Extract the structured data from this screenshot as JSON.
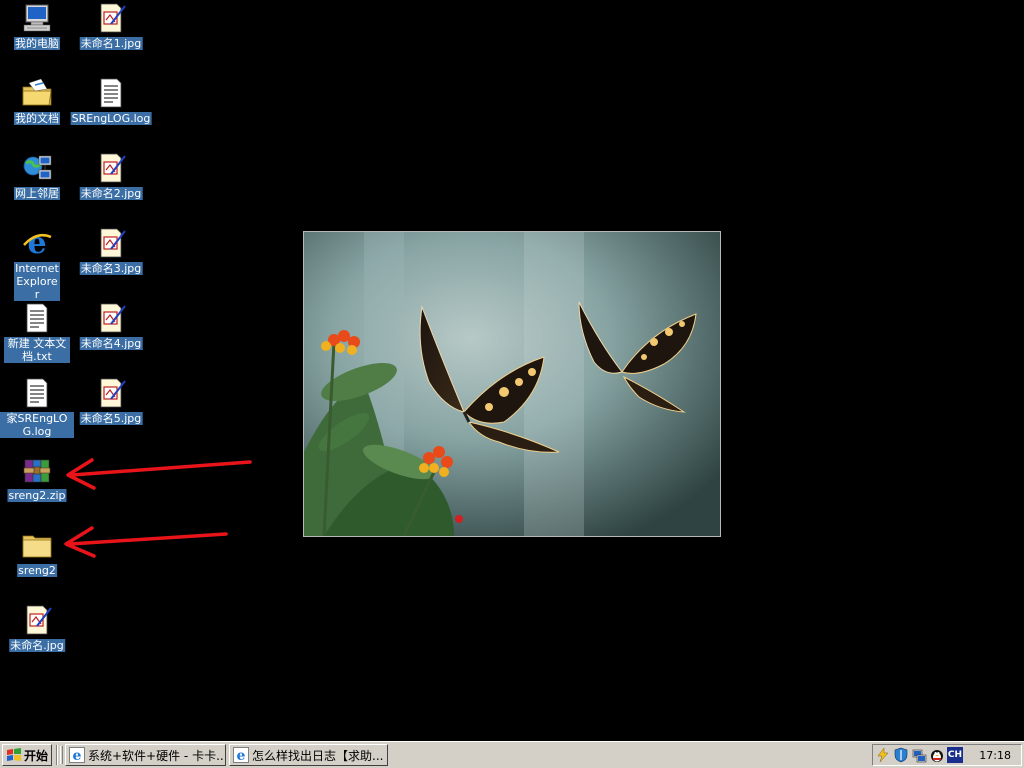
{
  "desktop": {
    "icons": [
      {
        "label": "我的电脑",
        "type": "computer"
      },
      {
        "label": "我的文档",
        "type": "documents"
      },
      {
        "label": "网上邻居",
        "type": "network"
      },
      {
        "label": "Internet Explorer",
        "type": "ie"
      },
      {
        "label": "新建 文本文档.txt",
        "type": "textfile"
      },
      {
        "label": "家SREngLOG.log",
        "type": "textfile"
      },
      {
        "label": "sreng2.zip",
        "type": "winrar-archive"
      },
      {
        "label": "sreng2",
        "type": "folder"
      },
      {
        "label": "未命名.jpg",
        "type": "jpg-image"
      },
      {
        "label": "未命名1.jpg",
        "type": "jpg-image"
      },
      {
        "label": "SREngLOG.log",
        "type": "textfile"
      },
      {
        "label": "未命名2.jpg",
        "type": "jpg-image"
      },
      {
        "label": "未命名3.jpg",
        "type": "jpg-image"
      },
      {
        "label": "未命名4.jpg",
        "type": "jpg-image"
      },
      {
        "label": "未命名5.jpg",
        "type": "jpg-image"
      }
    ],
    "annotation_color": "#e8141a",
    "selection_color": "#3a6ea5"
  },
  "taskbar": {
    "start_label": "开始",
    "tasks": [
      {
        "label": "系统+软件+硬件 - 卡卡...",
        "icon": "ie-icon"
      },
      {
        "label": "怎么样找出日志【求助...",
        "icon": "ie-icon"
      }
    ],
    "tray": {
      "ime": "CH",
      "clock": "17:18"
    }
  }
}
